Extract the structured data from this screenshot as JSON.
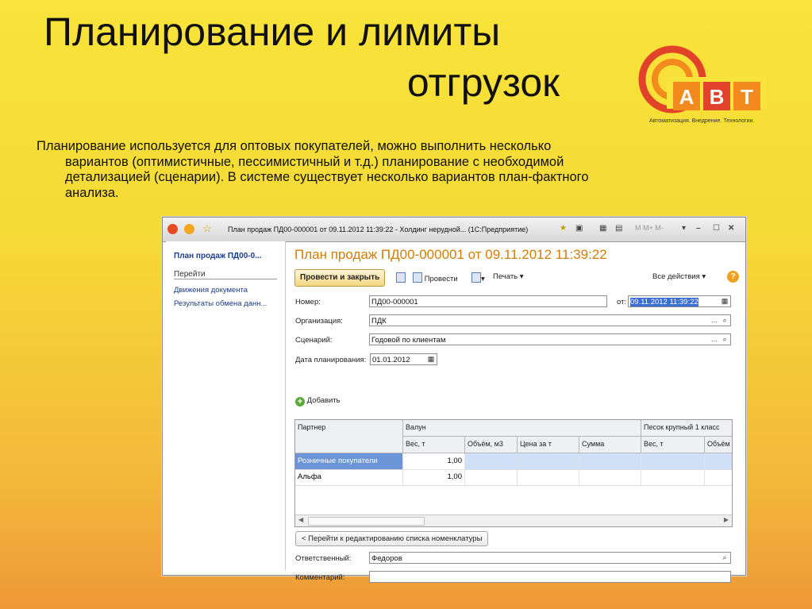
{
  "slide": {
    "title_line1": "Планирование и лимиты",
    "title_line2": "отгрузок",
    "bullet": "Планирование используется для оптовых покупателей, можно выполнить несколько вариантов (оптимистичные, пессимистичный и т.д.) планирование с необходимой детализацией (сценарии). В системе существует несколько вариантов план-фактного анализа.",
    "logo_text": "АВТ",
    "logo_tagline": "Автоматизация. Внедрение. Технологии."
  },
  "window": {
    "title": "План продаж ПД00-000001 от 09.11.2012 11:39:22 - Холдинг нерудной... (1С:Предприятие)",
    "right_controls": "M  M+  M-",
    "colors": {
      "accent_orange": "#d37d05",
      "link_blue": "#1b3d87",
      "selection": "#3a6ed1",
      "row_selected": "#6b95d6",
      "row_highlight": "#cfe0f7"
    }
  },
  "sidebar": {
    "doc_link": "План продаж ПД00-0...",
    "section": "Перейти",
    "links": [
      "Движения документа",
      "Результаты обмена данн..."
    ]
  },
  "form": {
    "title": "План продаж ПД00-000001 от 09.11.2012 11:39:22",
    "toolbar": {
      "post_close": "Провести и закрыть",
      "post": "Провести",
      "print": "Печать ▾",
      "all_actions": "Все действия ▾",
      "help": "?"
    },
    "number_label": "Номер:",
    "number_value": "ПД00-000001",
    "date_label": "от:",
    "date_value": "09.11.2012 11:39:22",
    "org_label": "Организация:",
    "org_value": "ПДК",
    "scenario_label": "Сценарий:",
    "scenario_value": "Годовой по клиентам",
    "plan_date_label": "Дата планирования:",
    "plan_date_value": "01.01.2012",
    "add_label": "Добавить",
    "table": {
      "partner_header": "Партнер",
      "group1": "Валун",
      "group2": "Песок крупный 1 класс",
      "subheaders": [
        "Вес, т",
        "Объём, м3",
        "Цена за т",
        "Сумма",
        "Вес, т",
        "Объём"
      ],
      "rows": [
        {
          "partner": "Розничные покупатели",
          "weight": "1,00"
        },
        {
          "partner": "Альфа",
          "weight": "1,00"
        }
      ]
    },
    "goto_button": "< Перейти к редактированию списка номенклатуры",
    "responsible_label": "Ответственный:",
    "responsible_value": "Федоров",
    "comment_label": "Комментарий:",
    "comment_value": ""
  }
}
